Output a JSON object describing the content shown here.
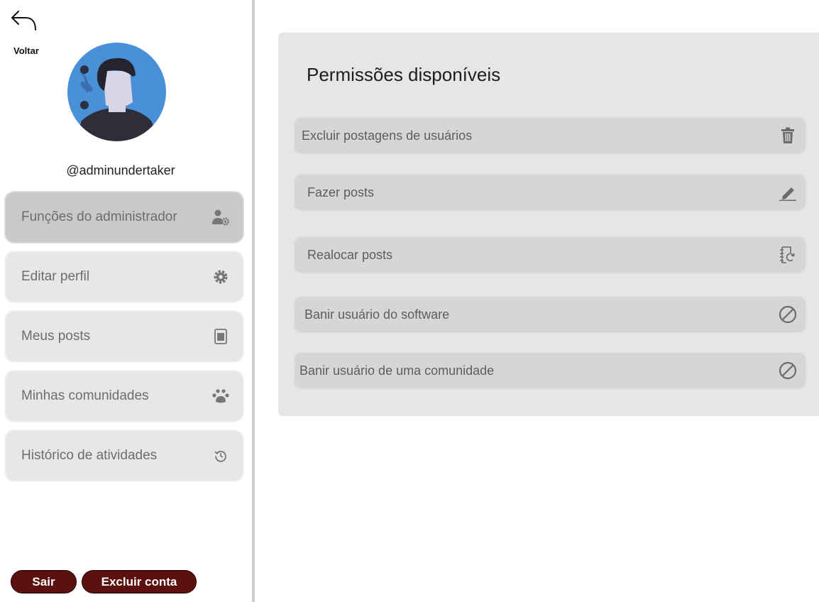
{
  "nav": {
    "back_label": "Voltar"
  },
  "profile": {
    "username": "@adminundertaker"
  },
  "menu": [
    {
      "label": "Funções do administrador",
      "icon": "user-gear-icon",
      "active": true
    },
    {
      "label": "Editar perfil",
      "icon": "gear-icon",
      "active": false
    },
    {
      "label": "Meus posts",
      "icon": "document-icon",
      "active": false
    },
    {
      "label": "Minhas comunidades",
      "icon": "paw-icon",
      "active": false
    },
    {
      "label": "Histórico de atividades",
      "icon": "history-icon",
      "active": false
    }
  ],
  "actions": {
    "logout_label": "Sair",
    "delete_account_label": "Excluir conta"
  },
  "panel": {
    "title": "Permissões disponíveis",
    "permissions": [
      {
        "label": "Excluir postagens de usuários",
        "icon": "trash-icon"
      },
      {
        "label": "Fazer posts",
        "icon": "pencil-icon"
      },
      {
        "label": "Realocar posts",
        "icon": "relocate-icon"
      },
      {
        "label": "Banir usuário do software",
        "icon": "ban-icon"
      },
      {
        "label": "Banir usuário de uma comunidade",
        "icon": "ban-icon"
      }
    ]
  },
  "colors": {
    "danger_button": "#5c1111",
    "active_menu": "#c8cac9",
    "menu_item": "#e6e7e6",
    "panel": "#e5e6e5",
    "permission_row": "#d5d7d6",
    "avatar_bg": "#4a90d9"
  }
}
